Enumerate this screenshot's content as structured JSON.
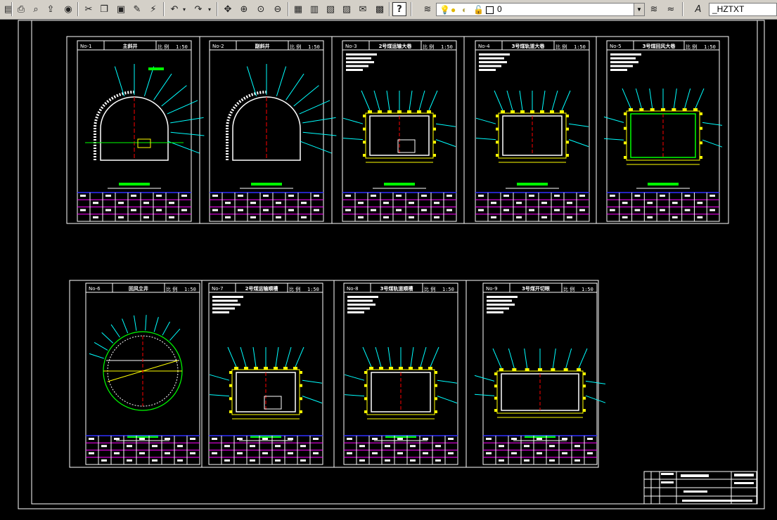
{
  "toolbar": {
    "layer_name": "0",
    "text_style": "_HZTXT",
    "colors": {
      "bg": "#d4d0c8",
      "bulb": "#ffd800",
      "sun": "#ffd800"
    }
  },
  "drawing": {
    "colors": {
      "frame": "#ffffff",
      "cyan": "#00ffff",
      "yellow": "#ffff00",
      "green": "#00ff00",
      "magenta": "#ff00ff",
      "red": "#ff0000",
      "blue": "#3030ff"
    },
    "sheets": [
      {
        "no": "No-1",
        "title": "主斜井",
        "scale_label": "比 例",
        "scale": "1:50"
      },
      {
        "no": "No-2",
        "title": "副斜井",
        "scale_label": "比 例",
        "scale": "1:50"
      },
      {
        "no": "No-3",
        "title": "2号煤运输大巷",
        "scale_label": "比 例",
        "scale": "1:50"
      },
      {
        "no": "No-4",
        "title": "3号煤轨道大巷",
        "scale_label": "比 例",
        "scale": "1:50"
      },
      {
        "no": "No-5",
        "title": "3号煤回风大巷",
        "scale_label": "比 例",
        "scale": "1:50"
      },
      {
        "no": "No-6",
        "title": "回风立井",
        "scale_label": "比 例",
        "scale": "1:50"
      },
      {
        "no": "No-7",
        "title": "2号煤运输顺槽",
        "scale_label": "比 例",
        "scale": "1:50"
      },
      {
        "no": "No-8",
        "title": "3号煤轨道顺槽",
        "scale_label": "比 例",
        "scale": "1:50"
      },
      {
        "no": "No-9",
        "title": "3号煤开切眼",
        "scale_label": "比 例",
        "scale": "1:50"
      }
    ]
  }
}
